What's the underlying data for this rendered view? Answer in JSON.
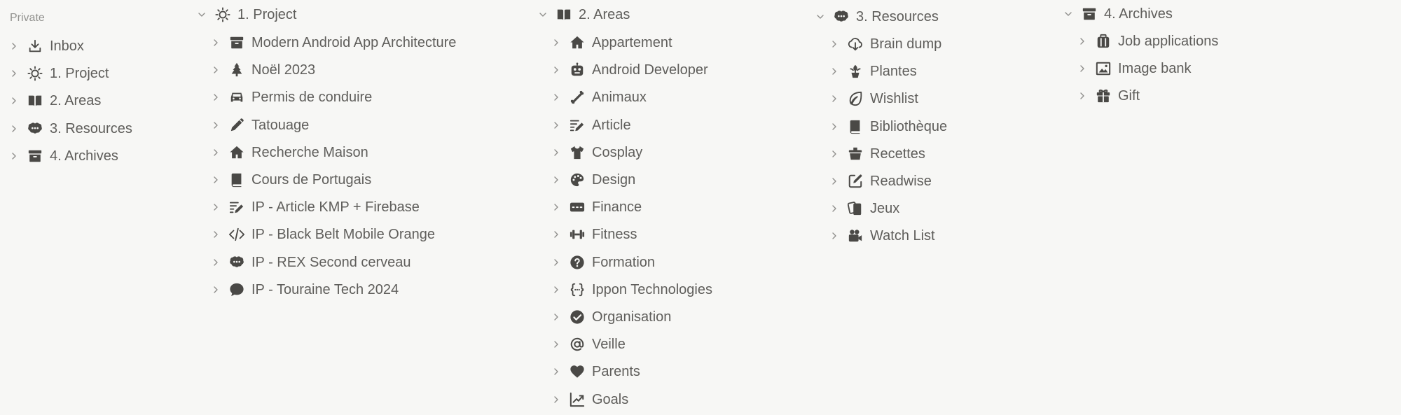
{
  "sidebar": {
    "section_label": "Private",
    "items": [
      {
        "label": "Inbox",
        "icon": "download-icon"
      },
      {
        "label": "1. Project",
        "icon": "sun-icon"
      },
      {
        "label": "2. Areas",
        "icon": "book-open-icon"
      },
      {
        "label": "3. Resources",
        "icon": "brain-icon"
      },
      {
        "label": "4. Archives",
        "icon": "archive-box-icon"
      }
    ]
  },
  "project": {
    "title": "1. Project",
    "icon": "sun-icon",
    "items": [
      {
        "label": "Modern Android App Architecture",
        "icon": "archive-box-icon"
      },
      {
        "label": "Noël 2023",
        "icon": "tree-icon"
      },
      {
        "label": "Permis de conduire",
        "icon": "car-icon"
      },
      {
        "label": "Tatouage",
        "icon": "pencil-icon"
      },
      {
        "label": "Recherche Maison",
        "icon": "house-icon"
      },
      {
        "label": "Cours de Portugais",
        "icon": "book-icon"
      },
      {
        "label": "IP - Article KMP + Firebase",
        "icon": "edit-lines-icon"
      },
      {
        "label": "IP - Black Belt Mobile Orange",
        "icon": "code-icon"
      },
      {
        "label": "IP - REX Second cerveau",
        "icon": "brain-icon"
      },
      {
        "label": "IP - Touraine Tech 2024",
        "icon": "chat-bubble-icon"
      }
    ]
  },
  "areas": {
    "title": "2. Areas",
    "icon": "book-open-icon",
    "items": [
      {
        "label": "Appartement",
        "icon": "house-icon"
      },
      {
        "label": "Android Developer",
        "icon": "robot-icon"
      },
      {
        "label": "Animaux",
        "icon": "bone-icon"
      },
      {
        "label": "Article",
        "icon": "edit-lines-icon"
      },
      {
        "label": "Cosplay",
        "icon": "tshirt-icon"
      },
      {
        "label": "Design",
        "icon": "palette-icon"
      },
      {
        "label": "Finance",
        "icon": "money-icon"
      },
      {
        "label": "Fitness",
        "icon": "dumbbell-icon"
      },
      {
        "label": "Formation",
        "icon": "question-icon"
      },
      {
        "label": "Ippon Technologies",
        "icon": "braces-icon"
      },
      {
        "label": "Organisation",
        "icon": "check-circle-icon"
      },
      {
        "label": "Veille",
        "icon": "at-icon"
      },
      {
        "label": "Parents",
        "icon": "heart-icon"
      },
      {
        "label": "Goals",
        "icon": "chart-line-icon"
      }
    ]
  },
  "resources": {
    "title": "3. Resources",
    "icon": "brain-icon",
    "items": [
      {
        "label": "Brain dump",
        "icon": "cloud-download-icon"
      },
      {
        "label": "Plantes",
        "icon": "plant-icon"
      },
      {
        "label": "Wishlist",
        "icon": "leaf-icon"
      },
      {
        "label": "Bibliothèque",
        "icon": "book-icon"
      },
      {
        "label": "Recettes",
        "icon": "basket-icon"
      },
      {
        "label": "Readwise",
        "icon": "edit-square-icon"
      },
      {
        "label": "Jeux",
        "icon": "cards-icon"
      },
      {
        "label": "Watch List",
        "icon": "video-camera-icon"
      }
    ]
  },
  "archives": {
    "title": "4. Archives",
    "icon": "archive-box-icon",
    "items": [
      {
        "label": "Job applications",
        "icon": "suitcase-icon"
      },
      {
        "label": "Image bank",
        "icon": "image-icon"
      },
      {
        "label": "Gift",
        "icon": "gift-icon"
      }
    ]
  },
  "colors": {
    "background": "#f7f7f5",
    "text": "#5f5e5b",
    "icon": "#4a4946",
    "muted": "#91918e"
  }
}
